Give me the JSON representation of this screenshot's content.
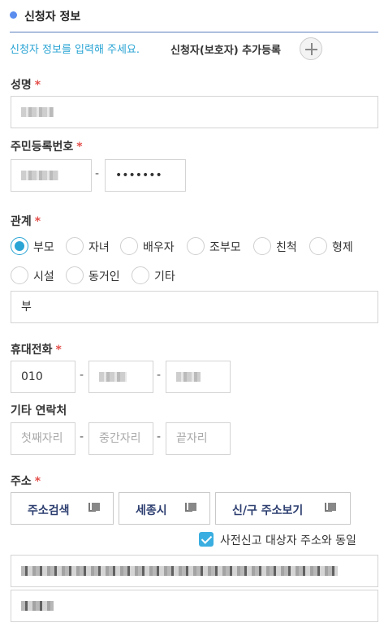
{
  "section": {
    "title": "신청자 정보"
  },
  "intro": {
    "text": "신청자 정보를 입력해 주세요.",
    "add_guardian_label": "신청자(보호자) 추가등록"
  },
  "name": {
    "label": "성명",
    "required_mark": "*"
  },
  "rrn": {
    "label": "주민등록번호",
    "required_mark": "*",
    "separator": "-",
    "back_value": "•••••••"
  },
  "relation": {
    "label": "관계",
    "required_mark": "*",
    "options": [
      "부모",
      "자녀",
      "배우자",
      "조부모",
      "친척",
      "형제",
      "시설",
      "동거인",
      "기타"
    ],
    "selected": "부모",
    "value": "부"
  },
  "mobile": {
    "label": "휴대전화",
    "required_mark": "*",
    "prefix": "010",
    "separator": "-"
  },
  "other_contact": {
    "label": "기타 연락처",
    "separator": "-",
    "placeholder_first": "첫째자리",
    "placeholder_middle": "중간자리",
    "placeholder_last": "끝자리"
  },
  "address": {
    "label": "주소",
    "required_mark": "*",
    "search_button": "주소검색",
    "sejong_button": "세종시",
    "view_button": "신/구 주소보기",
    "same_as_target_label": "사전신고 대상자 주소와 동일",
    "same_as_target_checked": true
  },
  "colors": {
    "accent": "#2aa4d4",
    "required": "#e4504c",
    "button_text": "#2d3e70",
    "header_dot": "#5b8def"
  }
}
